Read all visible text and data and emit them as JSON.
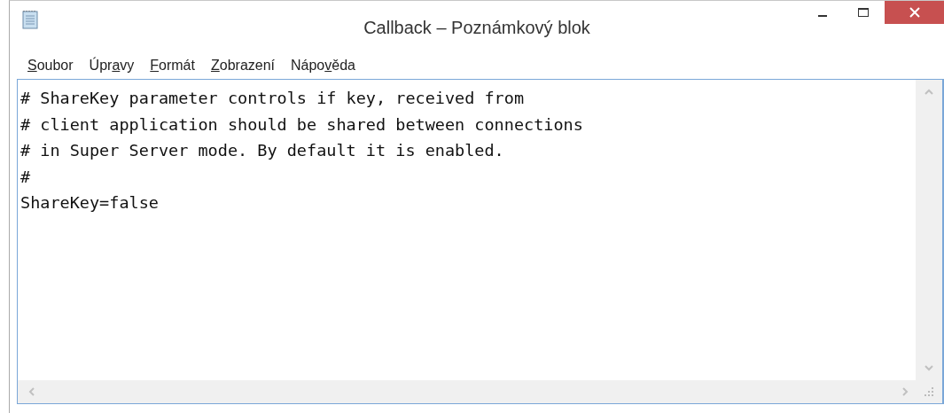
{
  "window": {
    "title": "Callback – Poznámkový blok"
  },
  "menu": [
    {
      "key": "S",
      "after": "oubor"
    },
    {
      "before": "Úpr",
      "key": "a",
      "after": "vy"
    },
    {
      "key": "F",
      "after": "ormát"
    },
    {
      "key": "Z",
      "after": "obrazení"
    },
    {
      "before": "Nápo",
      "key": "v",
      "after": "ěda"
    }
  ],
  "editor": {
    "lines": [
      "# ShareKey parameter controls if key, received from",
      "# client application should be shared between connections",
      "# in Super Server mode. By default it is enabled.",
      "#",
      "ShareKey=false"
    ]
  }
}
